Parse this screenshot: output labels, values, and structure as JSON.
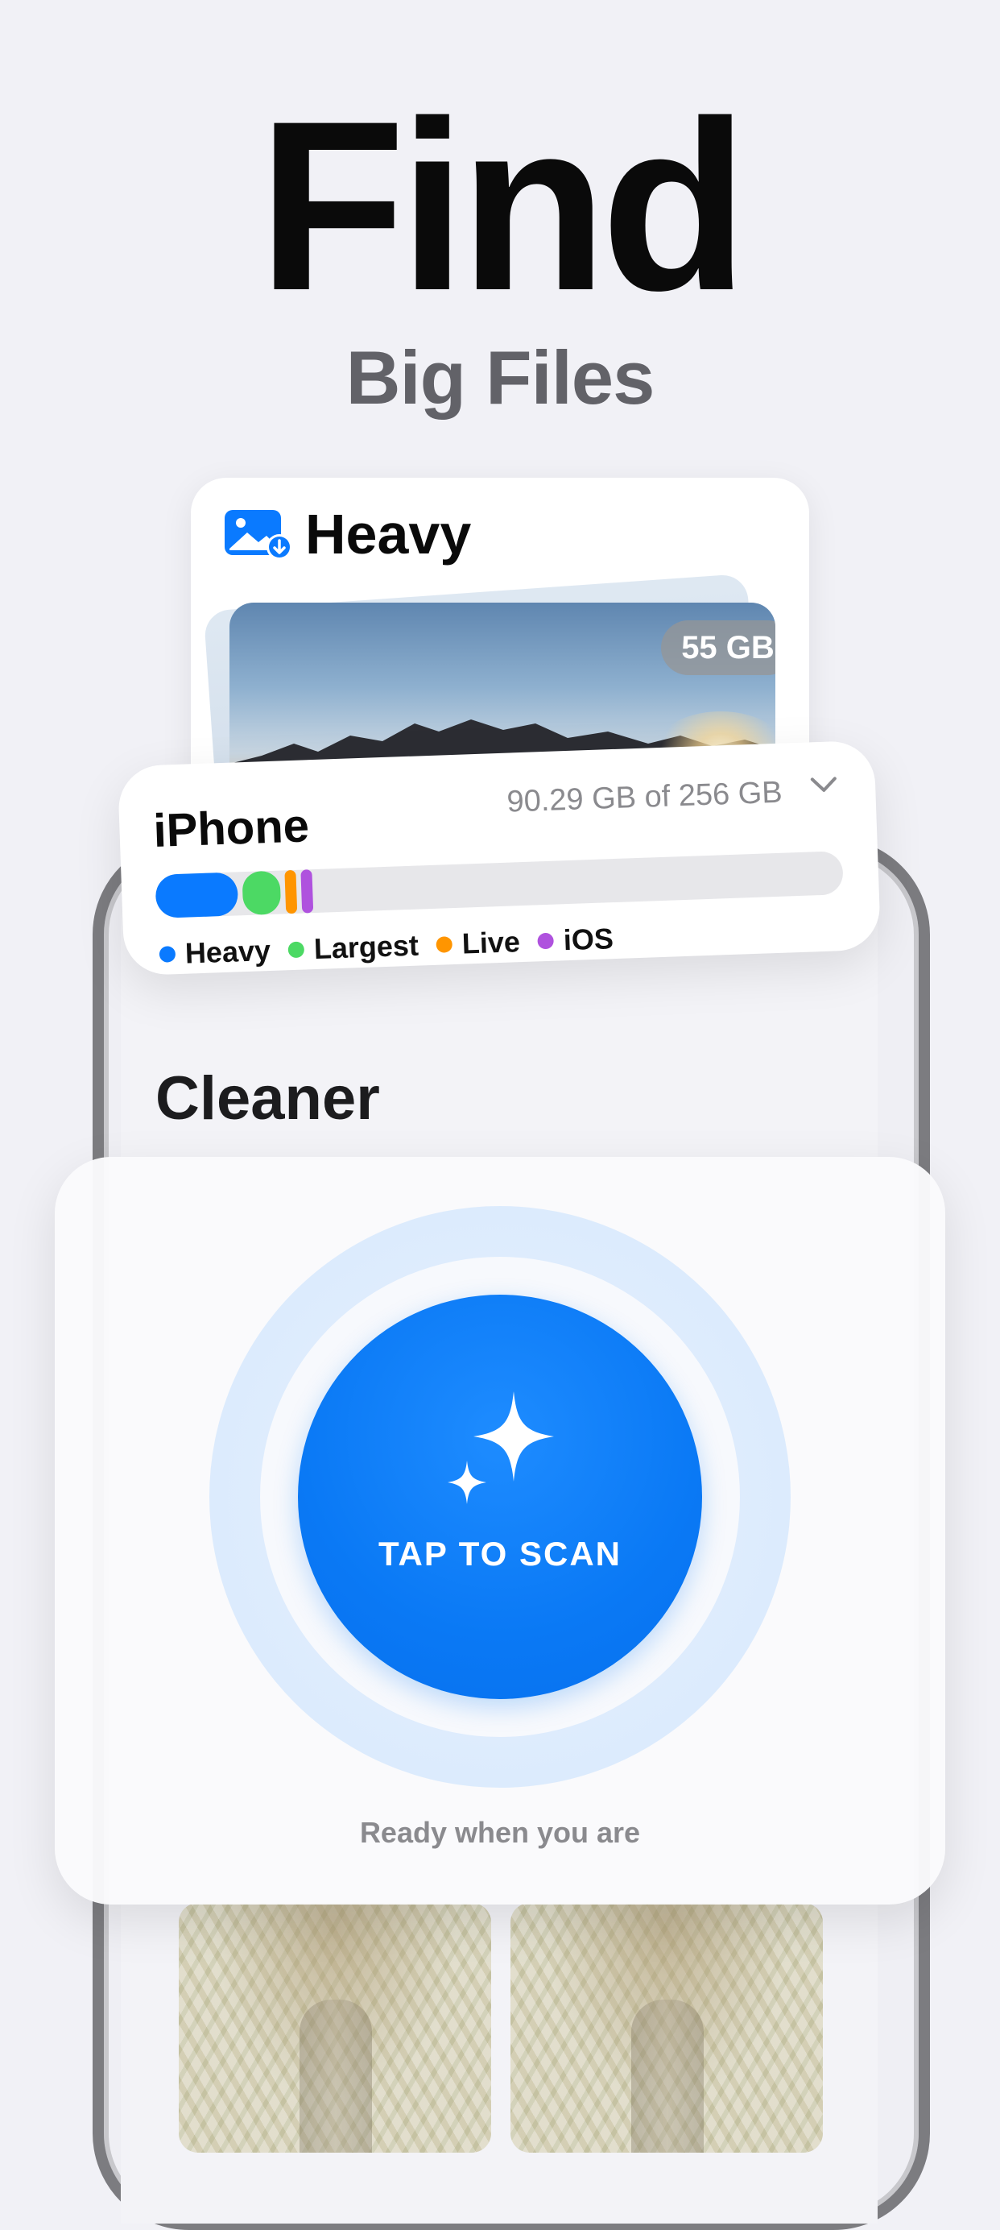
{
  "hero": {
    "title": "Find",
    "subtitle": "Big Files"
  },
  "heavy_card": {
    "label": "Heavy",
    "icon": "photo-download-icon",
    "size_badge": "55 GB"
  },
  "storage_card": {
    "device": "iPhone",
    "usage_text": "90.29 GB of 256 GB",
    "used_gb": 90.29,
    "total_gb": 256,
    "segments": [
      {
        "name": "Heavy",
        "fraction": 0.12,
        "color": "#0a7aff"
      },
      {
        "name": "Largest",
        "fraction": 0.055,
        "color": "#4cd964"
      },
      {
        "name": "Live",
        "fraction": 0.015,
        "color": "#ff9500"
      },
      {
        "name": "iOS",
        "fraction": 0.008,
        "color": "#af52de"
      }
    ],
    "legend": [
      {
        "label": "Heavy",
        "color": "#0a7aff"
      },
      {
        "label": "Largest",
        "color": "#4cd964"
      },
      {
        "label": "Live",
        "color": "#ff9500"
      },
      {
        "label": "iOS",
        "color": "#af52de"
      }
    ]
  },
  "screen": {
    "section_title": "Cleaner"
  },
  "scan": {
    "button_label": "TAP TO SCAN",
    "caption": "Ready when you are",
    "icon": "sparkles-icon"
  }
}
